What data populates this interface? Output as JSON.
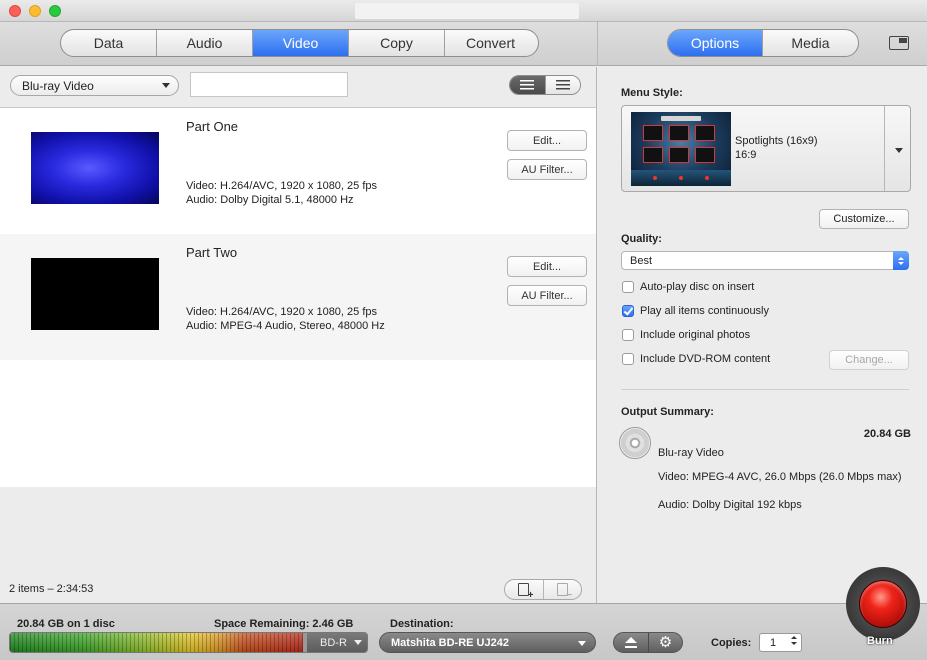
{
  "tabs": {
    "main": [
      {
        "label": "Data",
        "active": false
      },
      {
        "label": "Audio",
        "active": false
      },
      {
        "label": "Video",
        "active": true
      },
      {
        "label": "Copy",
        "active": false
      },
      {
        "label": "Convert",
        "active": false
      }
    ],
    "right": [
      {
        "label": "Options",
        "active": true
      },
      {
        "label": "Media",
        "active": false
      }
    ]
  },
  "left": {
    "format_select": "Blu-ray Video",
    "search_value": "",
    "items": [
      {
        "title": "Part One",
        "video": "Video: H.264/AVC, 1920 x 1080, 25 fps",
        "audio": "Audio: Dolby Digital 5.1, 48000 Hz",
        "edit_label": "Edit...",
        "filter_label": "AU Filter..."
      },
      {
        "title": "Part Two",
        "video": "Video: H.264/AVC, 1920 x 1080, 25 fps",
        "audio": "Audio: MPEG-4 Audio, Stereo, 48000 Hz",
        "edit_label": "Edit...",
        "filter_label": "AU Filter..."
      }
    ],
    "status": "2 items – 2:34:53"
  },
  "options": {
    "menu_style_label": "Menu Style:",
    "menu_style_name": "Spotlights (16x9)",
    "menu_style_ratio": "16:9",
    "menu_thumb_title": "My Movie",
    "customize_label": "Customize...",
    "quality_label": "Quality:",
    "quality_value": "Best",
    "checkboxes": [
      {
        "label": "Auto-play disc on insert",
        "checked": false
      },
      {
        "label": "Play all items continuously",
        "checked": true
      },
      {
        "label": "Include original photos",
        "checked": false
      },
      {
        "label": "Include DVD-ROM content",
        "checked": false
      }
    ],
    "change_label": "Change...",
    "summary_label": "Output Summary:",
    "summary_size": "20.84 GB",
    "summary_format": "Blu-ray Video",
    "summary_video": "Video: MPEG-4 AVC, 26.0 Mbps (26.0 Mbps max)",
    "summary_audio": "Audio: Dolby Digital 192 kbps"
  },
  "bottom": {
    "usage_text": "20.84 GB on 1 disc",
    "remaining_text": "Space Remaining: 2.46 GB",
    "capacity_fill_fraction": 0.82,
    "disc_type": "BD-R",
    "destination_label": "Destination:",
    "destination_value": "Matshita BD-RE UJ242",
    "copies_label": "Copies:",
    "copies_value": "1",
    "burn_label": "Burn"
  },
  "colors": {
    "accent": "#2e6ff0",
    "burn_red": "#f0241a"
  },
  "icons": [
    "close-icon",
    "minimize-icon",
    "maximize-icon",
    "window-icon",
    "list-view-icon",
    "detail-view-icon",
    "add-item-icon",
    "remove-item-icon",
    "disc-icon",
    "eject-icon",
    "gear-icon"
  ]
}
